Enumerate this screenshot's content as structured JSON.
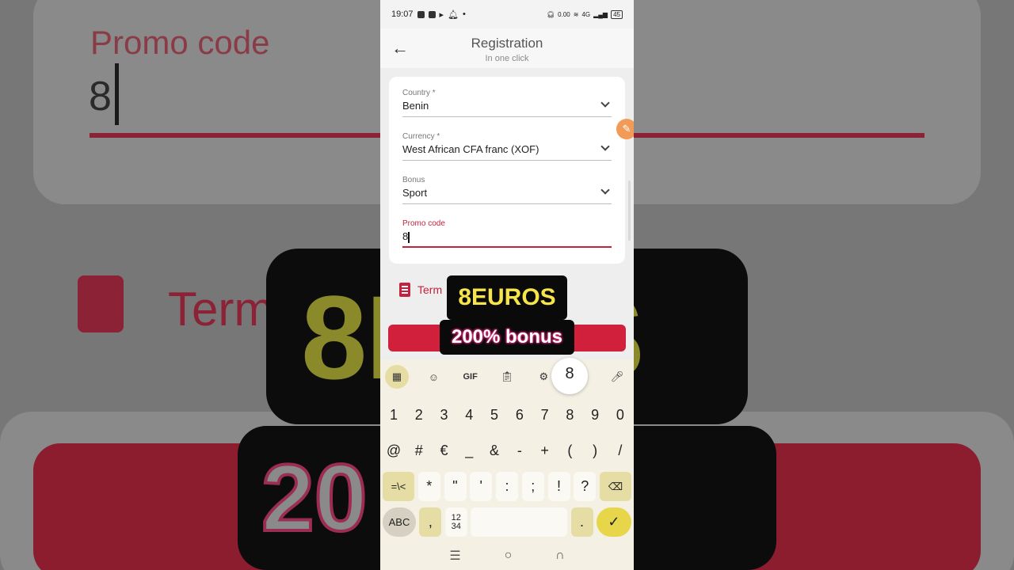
{
  "status_bar": {
    "time": "19:07",
    "network": "4G",
    "battery": "45",
    "speed": "0.00"
  },
  "app_bar": {
    "title": "Registration",
    "subtitle": "In one click"
  },
  "form": {
    "country": {
      "label": "Country *",
      "value": "Benin"
    },
    "currency": {
      "label": "Currency *",
      "value": "West African CFA franc (XOF)"
    },
    "bonus": {
      "label": "Bonus",
      "value": "Sport"
    },
    "promo": {
      "label": "Promo code",
      "value": "8"
    }
  },
  "terms": {
    "label": "Term"
  },
  "overlay": {
    "code": "8EUROS",
    "bonus": "200% bonus"
  },
  "background": {
    "promo_label": "Promo code",
    "promo_value": "8",
    "terms": "Term",
    "big_code": "8E  OS",
    "big_bonus": "20   nus"
  },
  "keyboard": {
    "preview": "8",
    "tools": {
      "gif": "GIF"
    },
    "row1": [
      "1",
      "2",
      "3",
      "4",
      "5",
      "6",
      "7",
      "8",
      "9",
      "0"
    ],
    "row2": [
      "@",
      "#",
      "€",
      "_",
      "&",
      "-",
      "+",
      "(",
      ")",
      "/"
    ],
    "row3": [
      "=\\<",
      "*",
      "\"",
      "'",
      ":",
      ";",
      "!",
      "?"
    ],
    "row4": {
      "abc": "ABC",
      "comma": ",",
      "numpad": "12\n34",
      "period": "."
    }
  },
  "colors": {
    "accent": "#d0203b",
    "caption_yellow": "#f5e44a",
    "keyboard_bg": "#f4f0e4"
  }
}
